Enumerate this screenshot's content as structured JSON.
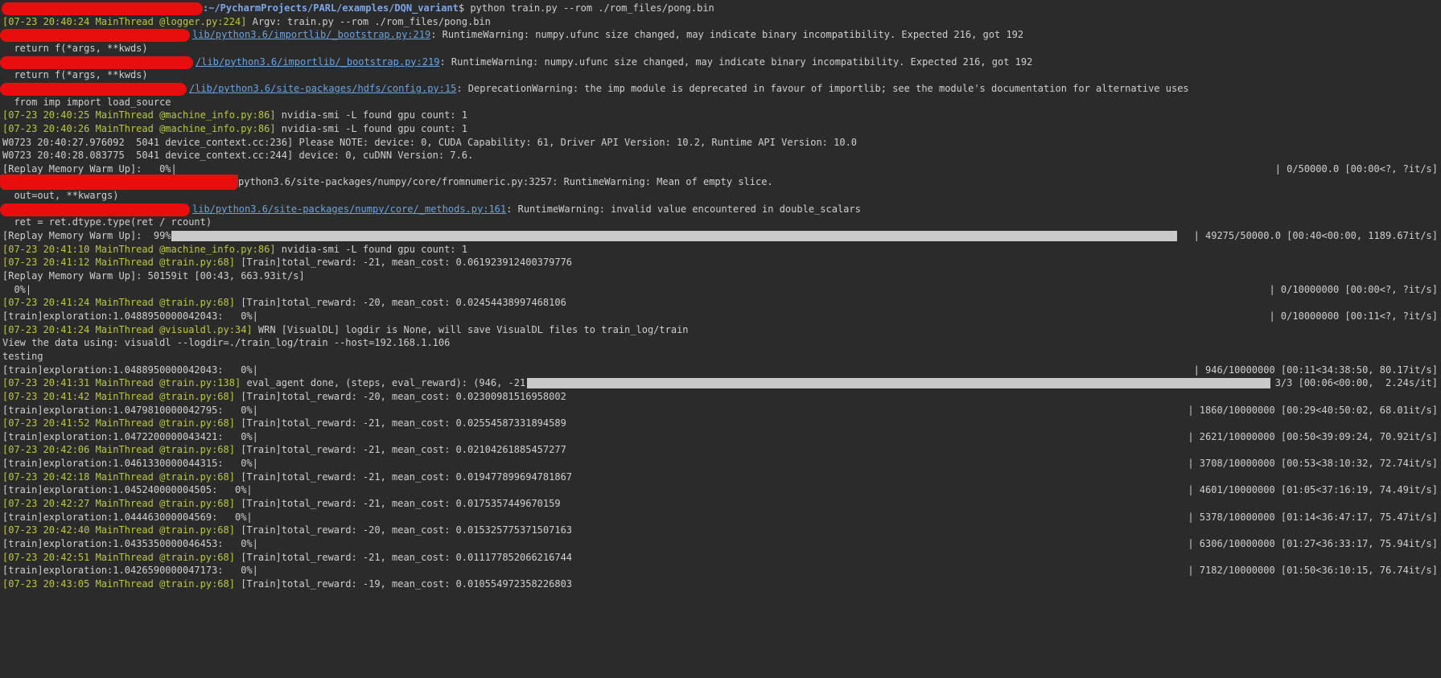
{
  "terminal": {
    "prompt_path": ":~/PycharmProjects/PARL/examples/DQN_variant",
    "prompt_suffix": "$ ",
    "command": "python train.py --rom ./rom_files/pong.bin"
  },
  "lines": [
    {
      "type": "prompt"
    },
    {
      "type": "log",
      "ts": "[07-23 20:40:24 MainThread @logger.py:224]",
      "msg": " Argv: train.py --rom ./rom_files/pong.bin"
    },
    {
      "type": "warn",
      "link": "lib/python3.6/importlib/_bootstrap.py:219",
      "msg": ": RuntimeWarning: numpy.ufunc size changed, may indicate binary incompatibility. Expected 216, got 192"
    },
    {
      "type": "text",
      "text": "  return f(*args, **kwds)"
    },
    {
      "type": "warn",
      "link": "/lib/python3.6/importlib/_bootstrap.py:219",
      "msg": ": RuntimeWarning: numpy.ufunc size changed, may indicate binary incompatibility. Expected 216, got 192"
    },
    {
      "type": "text",
      "text": "  return f(*args, **kwds)"
    },
    {
      "type": "warn",
      "link": "/lib/python3.6/site-packages/hdfs/config.py:15",
      "msg": ": DeprecationWarning: the imp module is deprecated in favour of importlib; see the module's documentation for alternative uses"
    },
    {
      "type": "text",
      "text": "  from imp import load_source"
    },
    {
      "type": "log",
      "ts": "[07-23 20:40:25 MainThread @machine_info.py:86]",
      "msg": " nvidia-smi -L found gpu count: 1"
    },
    {
      "type": "log",
      "ts": "[07-23 20:40:26 MainThread @machine_info.py:86]",
      "msg": " nvidia-smi -L found gpu count: 1"
    },
    {
      "type": "text",
      "text": "W0723 20:40:27.976092  5041 device_context.cc:236] Please NOTE: device: 0, CUDA Capability: 61, Driver API Version: 10.2, Runtime API Version: 10.0"
    },
    {
      "type": "text",
      "text": "W0723 20:40:28.083775  5041 device_context.cc:244] device: 0, cuDNN Version: 7.6."
    },
    {
      "type": "progress",
      "left": "[Replay Memory Warm Up]:   0%|",
      "right": "| 0/50000.0 [00:00<?, ?it/s]"
    },
    {
      "type": "warn2",
      "text": "python3.6/site-packages/numpy/core/fromnumeric.py:3257: RuntimeWarning: Mean of empty slice."
    },
    {
      "type": "text",
      "text": "  out=out, **kwargs)"
    },
    {
      "type": "warn",
      "link": "lib/python3.6/site-packages/numpy/core/_methods.py:161",
      "msg": ": RuntimeWarning: invalid value encountered in double_scalars"
    },
    {
      "type": "text",
      "text": "  ret = ret.dtype.type(ret / rcount)"
    },
    {
      "type": "progress",
      "left": "[Replay Memory Warm Up]:  99%|",
      "right": "| 49275/50000.0 [00:40<00:00, 1189.67it/s]",
      "bar": 0.99
    },
    {
      "type": "log",
      "ts": "[07-23 20:41:10 MainThread @machine_info.py:86]",
      "msg": " nvidia-smi -L found gpu count: 1"
    },
    {
      "type": "log",
      "ts": "[07-23 20:41:12 MainThread @train.py:68]",
      "msg": " [Train]total_reward: -21, mean_cost: 0.061923912400379776"
    },
    {
      "type": "text",
      "text": "[Replay Memory Warm Up]: 50159it [00:43, 663.93it/s]"
    },
    {
      "type": "progress",
      "left": "  0%|",
      "right": "| 0/10000000 [00:00<?, ?it/s]"
    },
    {
      "type": "log",
      "ts": "[07-23 20:41:24 MainThread @train.py:68]",
      "msg": " [Train]total_reward: -20, mean_cost: 0.02454438997468106"
    },
    {
      "type": "progress",
      "left": "[train]exploration:1.0488950000042043:   0%|",
      "right": "| 0/10000000 [00:11<?, ?it/s]"
    },
    {
      "type": "log",
      "ts": "[07-23 20:41:24 MainThread @visualdl.py:34]",
      "msg": " WRN [VisualDL] logdir is None, will save VisualDL files to train_log/train"
    },
    {
      "type": "text",
      "text": "View the data using: visualdl --logdir=./train_log/train --host=192.168.1.106"
    },
    {
      "type": "text",
      "text": "testing"
    },
    {
      "type": "progress",
      "left": "[train]exploration:1.0488950000042043:   0%|",
      "right": "| 946/10000000 [00:11<34:38:50, 80.17it/s]"
    },
    {
      "type": "logbar",
      "ts": "[07-23 20:41:31 MainThread @train.py:138]",
      "msg": " eval_agent done, (steps, eval_reward): (946, -21.0)",
      "right": "| 3/3 [00:06<00:00,  2.24s/it]",
      "bar": 1.0
    },
    {
      "type": "log",
      "ts": "[07-23 20:41:42 MainThread @train.py:68]",
      "msg": " [Train]total_reward: -20, mean_cost: 0.02300981516958002"
    },
    {
      "type": "progress",
      "left": "[train]exploration:1.0479810000042795:   0%|",
      "right": "| 1860/10000000 [00:29<40:50:02, 68.01it/s]"
    },
    {
      "type": "log",
      "ts": "[07-23 20:41:52 MainThread @train.py:68]",
      "msg": " [Train]total_reward: -21, mean_cost: 0.02554587331894589"
    },
    {
      "type": "progress",
      "left": "[train]exploration:1.0472200000043421:   0%|",
      "right": "| 2621/10000000 [00:50<39:09:24, 70.92it/s]"
    },
    {
      "type": "log",
      "ts": "[07-23 20:42:06 MainThread @train.py:68]",
      "msg": " [Train]total_reward: -21, mean_cost: 0.02104261885457277"
    },
    {
      "type": "progress",
      "left": "[train]exploration:1.0461330000044315:   0%|",
      "right": "| 3708/10000000 [00:53<38:10:32, 72.74it/s]"
    },
    {
      "type": "log",
      "ts": "[07-23 20:42:18 MainThread @train.py:68]",
      "msg": " [Train]total_reward: -21, mean_cost: 0.019477899694781867"
    },
    {
      "type": "progress",
      "left": "[train]exploration:1.045240000004505:   0%|",
      "right": "| 4601/10000000 [01:05<37:16:19, 74.49it/s]"
    },
    {
      "type": "log",
      "ts": "[07-23 20:42:27 MainThread @train.py:68]",
      "msg": " [Train]total_reward: -21, mean_cost: 0.0175357449670159"
    },
    {
      "type": "progress",
      "left": "[train]exploration:1.044463000004569:   0%|",
      "right": "| 5378/10000000 [01:14<36:47:17, 75.47it/s]"
    },
    {
      "type": "log",
      "ts": "[07-23 20:42:40 MainThread @train.py:68]",
      "msg": " [Train]total_reward: -20, mean_cost: 0.015325775371507163"
    },
    {
      "type": "progress",
      "left": "[train]exploration:1.0435350000046453:   0%|",
      "right": "| 6306/10000000 [01:27<36:33:17, 75.94it/s]"
    },
    {
      "type": "log",
      "ts": "[07-23 20:42:51 MainThread @train.py:68]",
      "msg": " [Train]total_reward: -21, mean_cost: 0.011177852066216744"
    },
    {
      "type": "progress",
      "left": "[train]exploration:1.0426590000047173:   0%|",
      "right": "| 7182/10000000 [01:50<36:10:15, 76.74it/s]"
    },
    {
      "type": "log",
      "ts": "[07-23 20:43:05 MainThread @train.py:68]",
      "msg": " [Train]total_reward: -19, mean_cost: 0.010554972358226803"
    }
  ],
  "colors": {
    "background": "#2b2b2b",
    "text": "#cfcfcf",
    "timestamp": "#b9c938",
    "link": "#6aa3e0",
    "redaction": "#f20d0d",
    "progress_bar": "#c9c9c9"
  }
}
